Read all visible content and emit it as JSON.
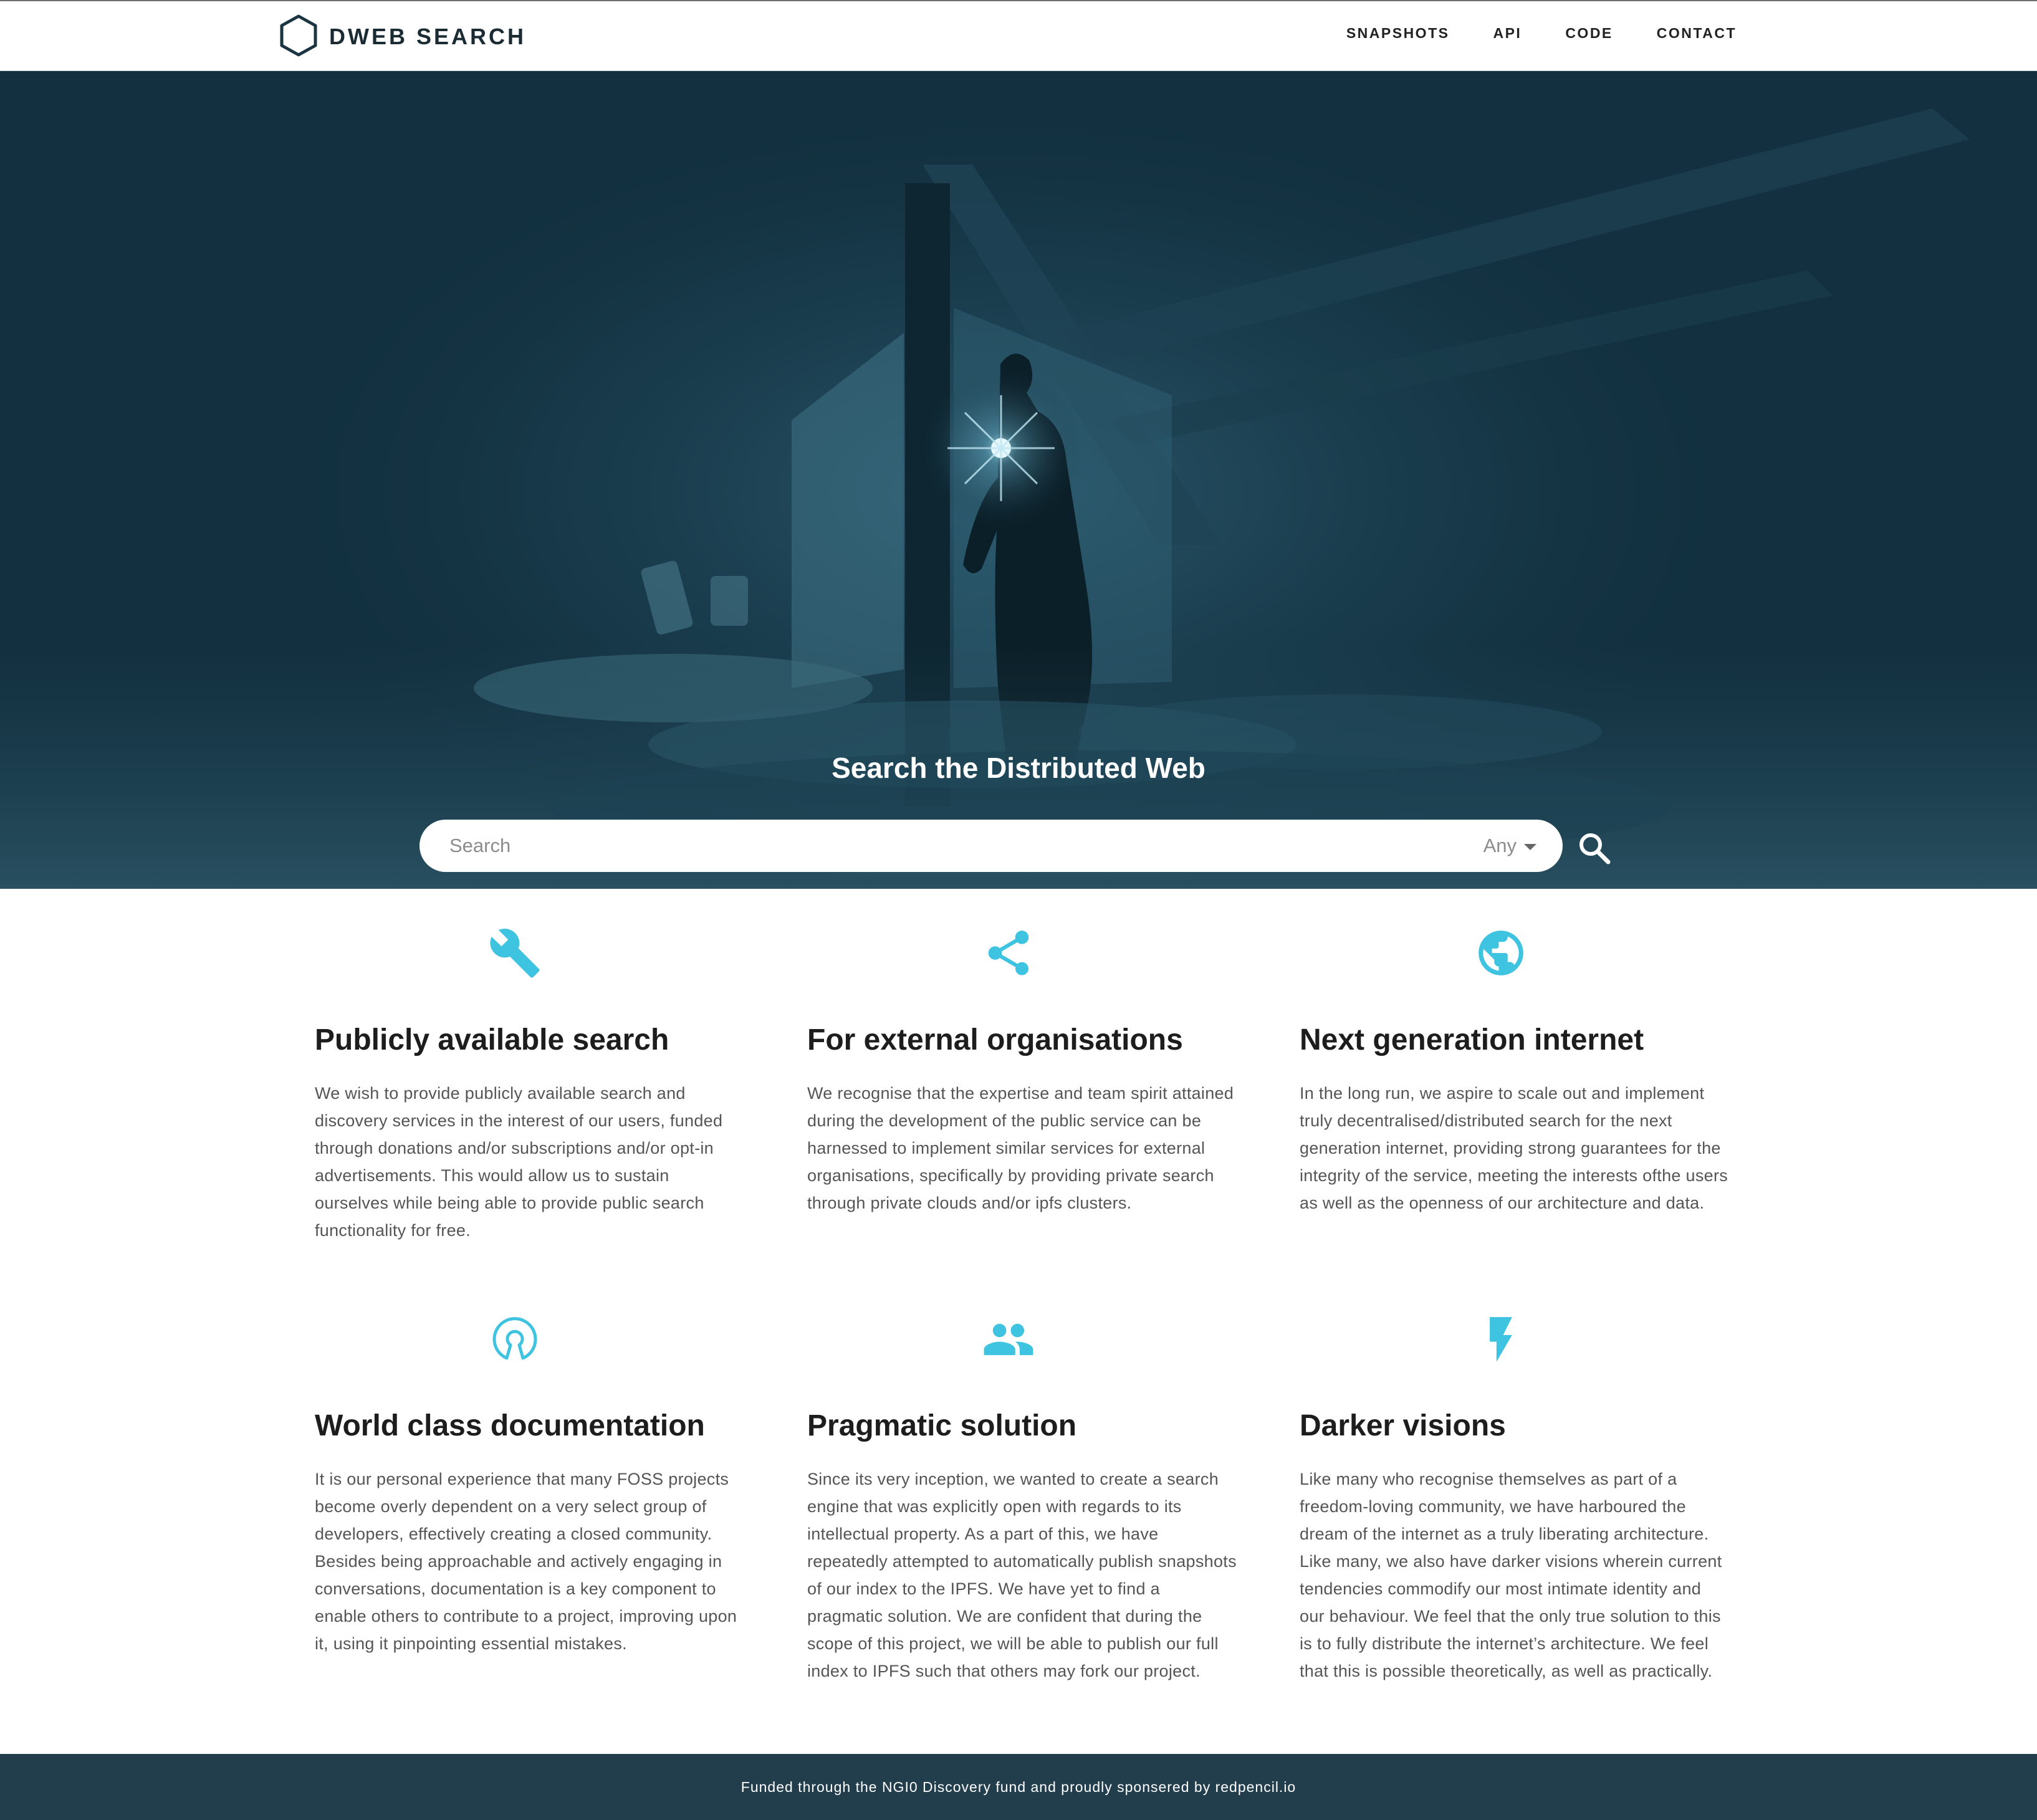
{
  "brand": {
    "name": "DWEB SEARCH",
    "logo_icon": "hexagon-icon"
  },
  "nav": {
    "items": [
      "SNAPSHOTS",
      "API",
      "CODE",
      "CONTACT"
    ]
  },
  "hero": {
    "title": "Search the Distributed Web",
    "search_placeholder": "Search",
    "scope_selected": "Any",
    "search_icon": "magnifier-icon"
  },
  "features": [
    {
      "icon": "wrench-icon",
      "title": "Publicly available search",
      "text": "We wish to provide publicly available search and discovery services in the interest of our users, funded through donations and/or subscriptions and/or opt-in advertisements. This would allow us to sustain ourselves while being able to provide public search functionality for free."
    },
    {
      "icon": "share-icon",
      "title": "For external organisations",
      "text": "We recognise that the expertise and team spirit attained during the development of the public service can be harnessed to implement similar services for external organisations, specifically by providing private search through private clouds and/or ipfs clusters."
    },
    {
      "icon": "globe-icon",
      "title": "Next generation internet",
      "text": "In the long run, we aspire to scale out and implement truly decentralised/distributed search for the next generation internet, providing strong guarantees for the integrity of the service, meeting the interests ofthe users as well as the openness of our architecture and data."
    },
    {
      "icon": "open-source-icon",
      "title": "World class documentation",
      "text": "It is our personal experience that many FOSS projects become overly dependent on a very select group of developers, effectively creating a closed community. Besides being approachable and actively engaging in conversations, documentation is a key component to enable others to contribute to a project, improving upon it, using it pinpointing essential mistakes."
    },
    {
      "icon": "people-icon",
      "title": "Pragmatic solution",
      "text": "Since its very inception, we wanted to create a search engine that was explicitly open with regards to its intellectual property. As a part of this, we have repeatedly attempted to automatically publish snapshots of our index to the IPFS. We have yet to find a pragmatic solution. We are confident that during the scope of this project, we will be able to publish our full index to IPFS such that others may fork our project."
    },
    {
      "icon": "lightning-icon",
      "title": "Darker visions",
      "text": "Like many who recognise themselves as part of a freedom-loving community, we have harboured the dream of the internet as a truly liberating architecture. Like many, we also have darker visions wherein current tendencies commodify our most intimate identity and our behaviour. We feel that the only true solution to this is to fully distribute the internet’s architecture. We feel that this is possible theoretically, as well as practically."
    }
  ],
  "footer": {
    "text": "Funded through the NGI0 Discovery fund and proudly sponsered by redpencil.io"
  },
  "colors": {
    "accent": "#3ec3e0",
    "hero_bg": "#12303f",
    "footer_bg": "#223e4d"
  }
}
